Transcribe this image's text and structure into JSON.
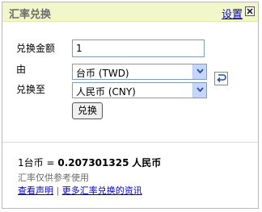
{
  "widget": {
    "title": "汇率兑换",
    "settings_label": "设置",
    "close_icon": "close-icon"
  },
  "form": {
    "amount_label": "兑换金额",
    "amount_value": "1",
    "from_label": "由",
    "from_value": "台币 (TWD)",
    "to_label": "兑换至",
    "to_value": "人民币 (CNY)",
    "convert_label": "兑换",
    "swap_icon": "swap-icon"
  },
  "result": {
    "source": "1台币",
    "equals": "=",
    "rate": "0.207301325",
    "target": "人民币"
  },
  "footer": {
    "note": "汇率仅供参考使用",
    "link_disclaimer": "查看声明",
    "separator": "|",
    "link_more": "更多汇率兑换的资讯"
  },
  "colors": {
    "title_bar": "#f2f7c9",
    "link": "#0000cc",
    "select_arrow": "#c4d6fb"
  }
}
